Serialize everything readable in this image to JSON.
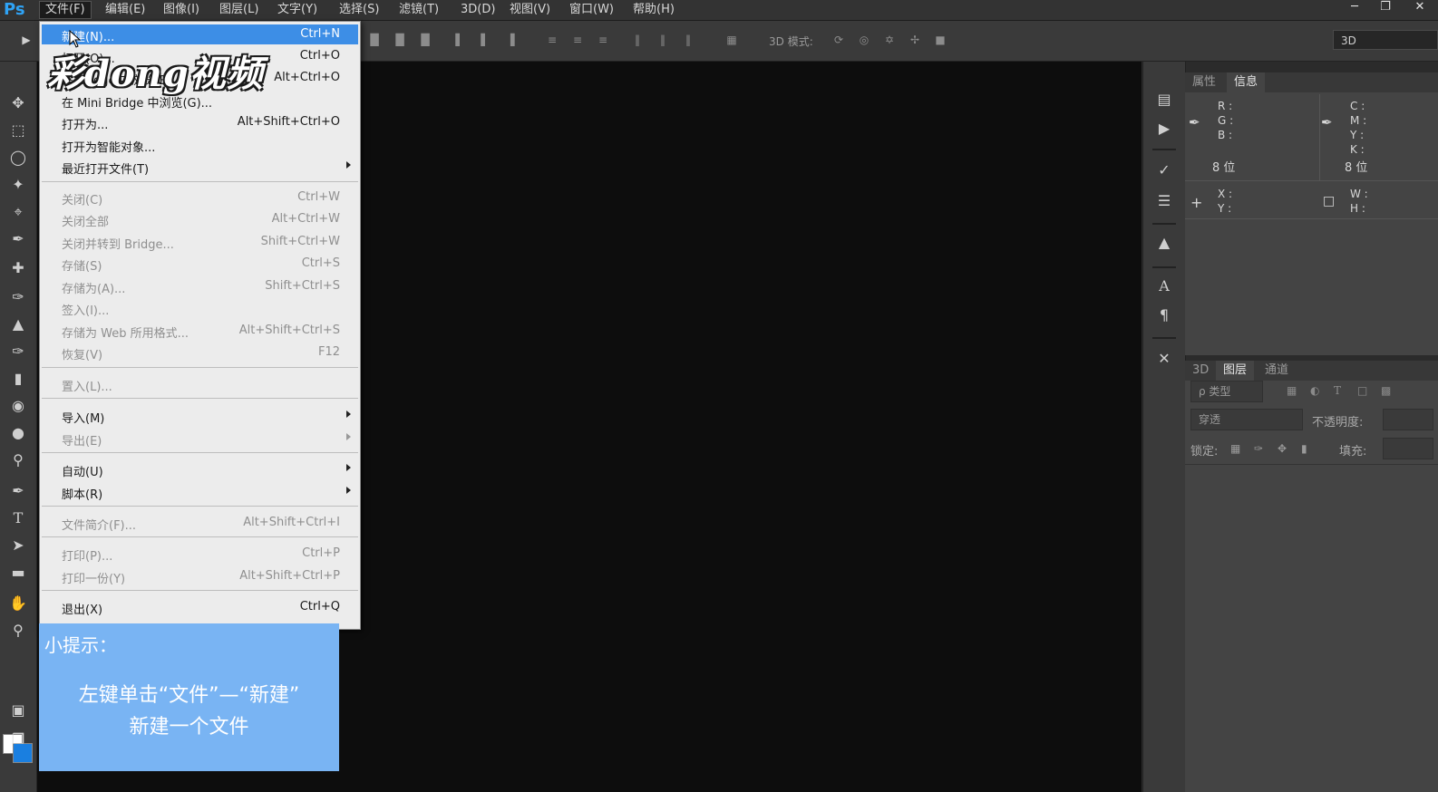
{
  "app": {
    "logo": "Ps"
  },
  "menubar": {
    "items": [
      "文件(F)",
      "编辑(E)",
      "图像(I)",
      "图层(L)",
      "文字(Y)",
      "选择(S)",
      "滤镜(T)",
      "3D(D)",
      "视图(V)",
      "窗口(W)",
      "帮助(H)"
    ],
    "window_controls": [
      "minimize",
      "restore",
      "close"
    ]
  },
  "options_bar": {
    "mode_3d_label": "3D 模式:",
    "workspace_value": "3D"
  },
  "file_menu": {
    "items": [
      {
        "label": "新建(N)...",
        "shortcut": "Ctrl+N",
        "enabled": true,
        "highlighted": true
      },
      {
        "label": "打开(O)...",
        "shortcut": "Ctrl+O",
        "enabled": true
      },
      {
        "label": "在 Bridge 中浏览(B)...",
        "shortcut": "Alt+Ctrl+O",
        "enabled": true
      },
      {
        "label": "在 Mini Bridge 中浏览(G)...",
        "shortcut": "",
        "enabled": true
      },
      {
        "label": "打开为...",
        "shortcut": "Alt+Shift+Ctrl+O",
        "enabled": true
      },
      {
        "label": "打开为智能对象...",
        "shortcut": "",
        "enabled": true
      },
      {
        "label": "最近打开文件(T)",
        "shortcut": "",
        "enabled": true,
        "submenu": true
      },
      {
        "label": "关闭(C)",
        "shortcut": "Ctrl+W",
        "enabled": false
      },
      {
        "label": "关闭全部",
        "shortcut": "Alt+Ctrl+W",
        "enabled": false
      },
      {
        "label": "关闭并转到 Bridge...",
        "shortcut": "Shift+Ctrl+W",
        "enabled": false
      },
      {
        "label": "存储(S)",
        "shortcut": "Ctrl+S",
        "enabled": false
      },
      {
        "label": "存储为(A)...",
        "shortcut": "Shift+Ctrl+S",
        "enabled": false
      },
      {
        "label": "签入(I)...",
        "shortcut": "",
        "enabled": false
      },
      {
        "label": "存储为 Web 所用格式...",
        "shortcut": "Alt+Shift+Ctrl+S",
        "enabled": false
      },
      {
        "label": "恢复(V)",
        "shortcut": "F12",
        "enabled": false
      },
      {
        "label": "置入(L)...",
        "shortcut": "",
        "enabled": false
      },
      {
        "label": "导入(M)",
        "shortcut": "",
        "enabled": true,
        "submenu": true
      },
      {
        "label": "导出(E)",
        "shortcut": "",
        "enabled": false,
        "submenu": true
      },
      {
        "label": "自动(U)",
        "shortcut": "",
        "enabled": true,
        "submenu": true
      },
      {
        "label": "脚本(R)",
        "shortcut": "",
        "enabled": true,
        "submenu": true
      },
      {
        "label": "文件简介(F)...",
        "shortcut": "Alt+Shift+Ctrl+I",
        "enabled": false
      },
      {
        "label": "打印(P)...",
        "shortcut": "Ctrl+P",
        "enabled": false
      },
      {
        "label": "打印一份(Y)",
        "shortcut": "Alt+Shift+Ctrl+P",
        "enabled": false
      },
      {
        "label": "退出(X)",
        "shortcut": "Ctrl+Q",
        "enabled": true
      }
    ]
  },
  "watermark": {
    "text": "彩dong视频"
  },
  "tip": {
    "title": "小提示：",
    "line1": "左键单击“文件”—“新建”",
    "line2": "新建一个文件"
  },
  "info_panel": {
    "tabs": [
      "属性",
      "信息"
    ],
    "active_tab": "信息",
    "rgb": [
      "R :",
      "G :",
      "B :"
    ],
    "cmyk": [
      "C :",
      "M :",
      "Y :",
      "K :"
    ],
    "bit_left": "8 位",
    "bit_right": "8 位",
    "xy": [
      "X :",
      "Y :"
    ],
    "wh": [
      "W :",
      "H :"
    ]
  },
  "layers_panel": {
    "tabs": [
      "3D",
      "图层",
      "通道"
    ],
    "active_tab": "图层",
    "filter_label": "ρ 类型",
    "blend_mode": "穿透",
    "opacity_label": "不透明度:",
    "lock_label": "锁定:",
    "fill_label": "填充:"
  },
  "colors": {
    "accent": "#3d8ee6",
    "tip_bg": "#79b4f3",
    "logo": "#2fa3f5"
  }
}
